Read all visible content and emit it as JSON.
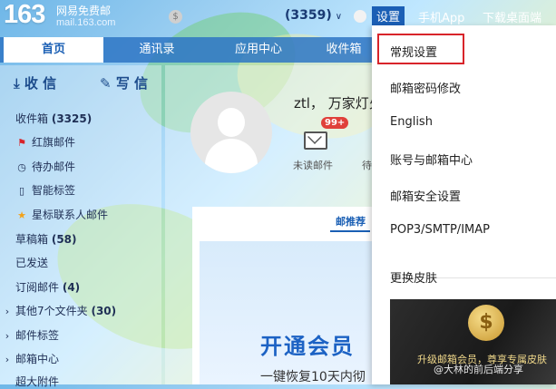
{
  "header": {
    "logo_number": "163",
    "logo_tagline": "网易免费邮",
    "logo_domain": "mail.163.com",
    "mail_count": "(3359)",
    "links": {
      "settings": "设置",
      "mobile_app": "手机App",
      "download_desktop": "下载桌面端"
    }
  },
  "nav_tabs": [
    "首页",
    "通讯录",
    "应用中心",
    "收件箱"
  ],
  "sidebar": {
    "receive_label": "收 信",
    "write_label": "写 信",
    "folders": [
      {
        "label": "收件箱",
        "count": "(3325)",
        "icon": "none"
      },
      {
        "label": "红旗邮件",
        "count": "",
        "icon": "flag-icon"
      },
      {
        "label": "待办邮件",
        "count": "",
        "icon": "clock-icon"
      },
      {
        "label": "智能标签",
        "count": "",
        "icon": "tag-icon"
      },
      {
        "label": "星标联系人邮件",
        "count": "",
        "icon": "star-icon"
      },
      {
        "label": "草稿箱",
        "count": "(58)",
        "icon": "none"
      },
      {
        "label": "已发送",
        "count": "",
        "icon": "none"
      },
      {
        "label": "订阅邮件",
        "count": "(4)",
        "icon": "none"
      },
      {
        "label": "其他7个文件夹",
        "count": "(30)",
        "icon": "caret-right-icon"
      },
      {
        "label": "邮件标签",
        "count": "",
        "icon": "caret-right-icon"
      },
      {
        "label": "邮箱中心",
        "count": "",
        "icon": "caret-right-icon"
      },
      {
        "label": "超大附件",
        "count": "",
        "icon": "none"
      }
    ]
  },
  "main": {
    "username": "ztl， 万家灯火",
    "unread_badge": "99+",
    "unread_label": "未读邮件",
    "pending_label": "待",
    "recommend_tab": "邮推荐",
    "promo_title": "开通会员",
    "promo_subtitle": "一键恢复10天内彻"
  },
  "settings_menu": {
    "items": [
      "常规设置",
      "邮箱密码修改",
      "English",
      "账号与邮箱中心",
      "邮箱安全设置",
      "POP3/SMTP/IMAP",
      "更换皮肤"
    ],
    "highlighted": "常规设置",
    "skin_banner_text": "升级邮箱会员，尊享专属皮肤"
  },
  "watermark": "@大林的前后端分享",
  "colors": {
    "accent": "#1a5fb4",
    "badge_red": "#e0403a",
    "highlight_border": "#d8242a"
  }
}
